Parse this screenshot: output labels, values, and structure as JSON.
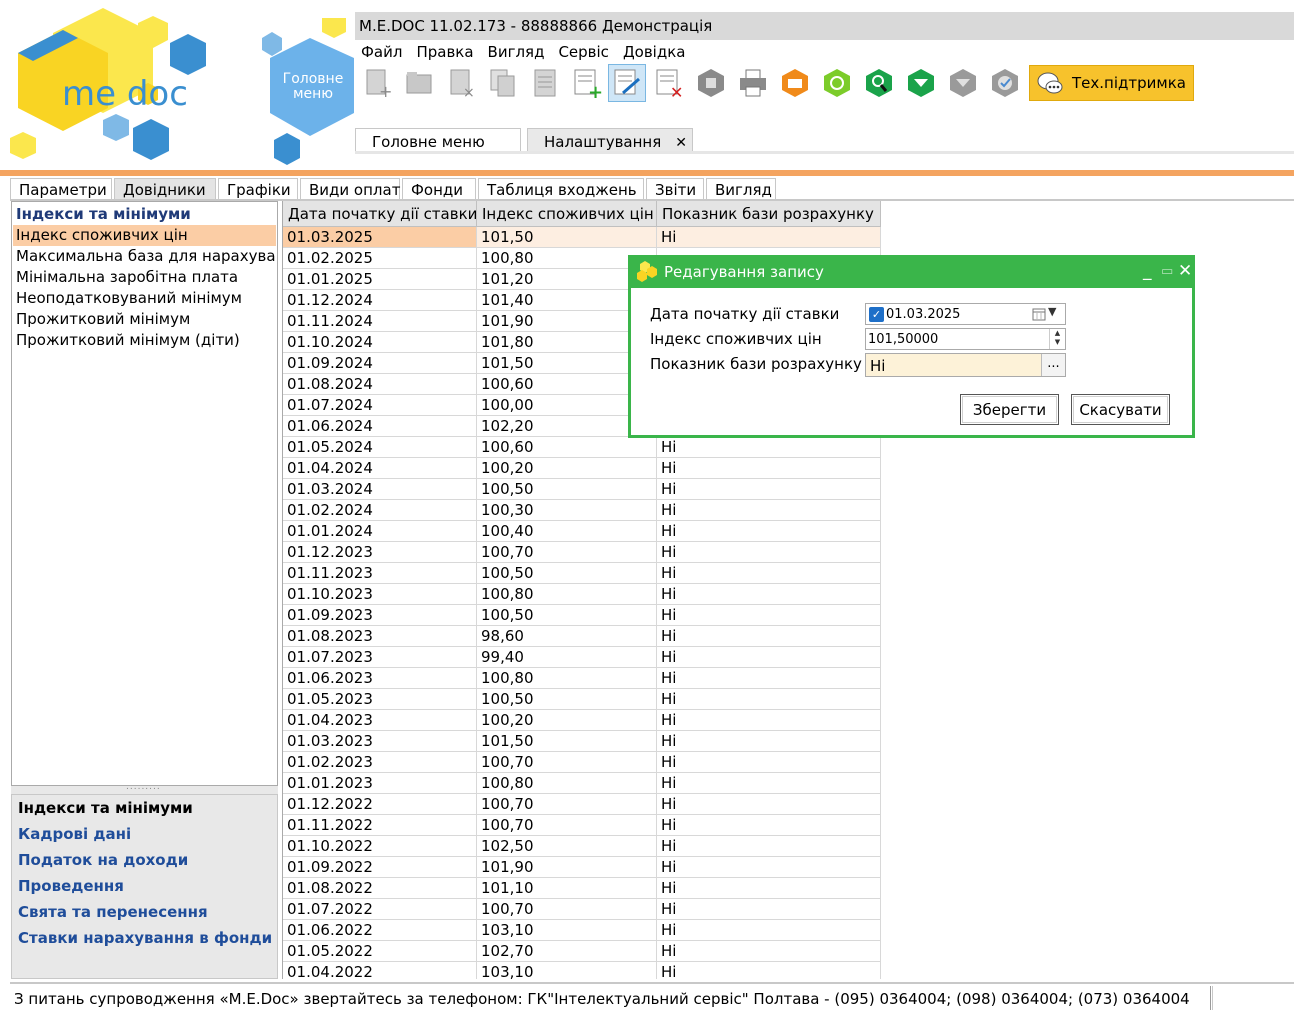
{
  "window": {
    "title": "M.E.DOC 11.02.173  - 88888866 Демонстрація"
  },
  "logo": {
    "text": "me doc",
    "main_menu_label": "Головне меню"
  },
  "menubar": [
    "Файл",
    "Правка",
    "Вигляд",
    "Сервіс",
    "Довідка"
  ],
  "toolbar": {
    "icons": [
      "new-doc-icon",
      "open-doc-icon",
      "delete-doc-icon",
      "copy-icon",
      "list-icon",
      "add-record-icon",
      "edit-record-icon",
      "delete-record-icon",
      "archive-icon",
      "print-icon",
      "send-icon",
      "refresh-icon",
      "search-icon",
      "receive-icon",
      "sign-icon",
      "check-icon"
    ],
    "support_label": "Тех.підтримка"
  },
  "doc_tabs": [
    {
      "label": "Головне меню",
      "active": false
    },
    {
      "label": "Налаштування",
      "active": true,
      "close": "✕"
    }
  ],
  "settings_tabs": [
    "Параметри",
    "Довідники",
    "Графіки",
    "Види оплат",
    "Фонди",
    "Таблиця входжень",
    "Звіти",
    "Вигляд"
  ],
  "settings_active_tab": "Довідники",
  "left_panel": {
    "title": "Індекси та мінімуми",
    "items": [
      "Індекс споживчих цін",
      "Максимальна база для нарахуван",
      "Мінімальна заробітна плата",
      "Неоподатковуваний мінімум",
      "Прожитковий мінімум",
      "Прожитковий мінімум (діти)"
    ],
    "selected": "Індекс споживчих цін",
    "splitter": "........."
  },
  "nav_groups": [
    "Індекси та мінімуми",
    "Кадрові дані",
    "Податок на доходи",
    "Проведення",
    "Свята та перенесення",
    "Ставки нарахування в фонди"
  ],
  "grid": {
    "columns": [
      "Дата початку дії ставки",
      "Індекс споживчих цін",
      "Показник бази розрахунку"
    ],
    "rows": [
      [
        "01.03.2025",
        "101,50",
        "Ні"
      ],
      [
        "01.02.2025",
        "100,80",
        ""
      ],
      [
        "01.01.2025",
        "101,20",
        ""
      ],
      [
        "01.12.2024",
        "101,40",
        ""
      ],
      [
        "01.11.2024",
        "101,90",
        ""
      ],
      [
        "01.10.2024",
        "101,80",
        ""
      ],
      [
        "01.09.2024",
        "101,50",
        ""
      ],
      [
        "01.08.2024",
        "100,60",
        ""
      ],
      [
        "01.07.2024",
        "100,00",
        ""
      ],
      [
        "01.06.2024",
        "102,20",
        ""
      ],
      [
        "01.05.2024",
        "100,60",
        "Ні"
      ],
      [
        "01.04.2024",
        "100,20",
        "Ні"
      ],
      [
        "01.03.2024",
        "100,50",
        "Ні"
      ],
      [
        "01.02.2024",
        "100,30",
        "Ні"
      ],
      [
        "01.01.2024",
        "100,40",
        "Ні"
      ],
      [
        "01.12.2023",
        "100,70",
        "Ні"
      ],
      [
        "01.11.2023",
        "100,50",
        "Ні"
      ],
      [
        "01.10.2023",
        "100,80",
        "Ні"
      ],
      [
        "01.09.2023",
        "100,50",
        "Ні"
      ],
      [
        "01.08.2023",
        "98,60",
        "Ні"
      ],
      [
        "01.07.2023",
        "99,40",
        "Ні"
      ],
      [
        "01.06.2023",
        "100,80",
        "Ні"
      ],
      [
        "01.05.2023",
        "100,50",
        "Ні"
      ],
      [
        "01.04.2023",
        "100,20",
        "Ні"
      ],
      [
        "01.03.2023",
        "101,50",
        "Ні"
      ],
      [
        "01.02.2023",
        "100,70",
        "Ні"
      ],
      [
        "01.01.2023",
        "100,80",
        "Ні"
      ],
      [
        "01.12.2022",
        "100,70",
        "Ні"
      ],
      [
        "01.11.2022",
        "100,70",
        "Ні"
      ],
      [
        "01.10.2022",
        "102,50",
        "Ні"
      ],
      [
        "01.09.2022",
        "101,90",
        "Ні"
      ],
      [
        "01.08.2022",
        "101,10",
        "Ні"
      ],
      [
        "01.07.2022",
        "100,70",
        "Ні"
      ],
      [
        "01.06.2022",
        "103,10",
        "Ні"
      ],
      [
        "01.05.2022",
        "102,70",
        "Ні"
      ],
      [
        "01.04.2022",
        "103,10",
        "Ні"
      ]
    ],
    "selected_row": 0
  },
  "dialog": {
    "title": "Редагування запису",
    "fields": [
      {
        "label": "Дата початку дії ставки",
        "value": "01.03.2025"
      },
      {
        "label": "Індекс споживчих цін",
        "value": "101,50000"
      },
      {
        "label": "Показник бази розрахунку",
        "value": "Ні",
        "button": "..."
      }
    ],
    "save_label": "Зберегти",
    "cancel_label": "Скасувати"
  },
  "statusbar": {
    "text": "З питань супроводження «M.E.Doc» звертайтесь за телефоном: ГК\"Інтелектуальний сервіс\" Полтава - (095) 0364004;  (098) 0364004;  (073) 0364004"
  },
  "colors": {
    "accent_orange": "#f4a460",
    "dialog_green": "#3ab54a",
    "support_yellow": "#f7c22c",
    "selection": "#fbcda5"
  }
}
